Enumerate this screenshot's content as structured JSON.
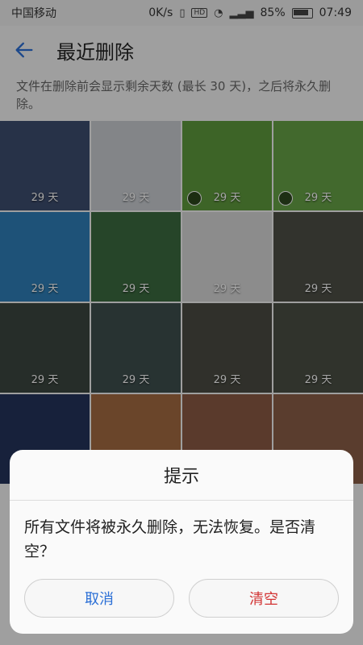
{
  "status": {
    "carrier": "中国移动",
    "speed": "0K/s",
    "battery": "85%",
    "time": "07:49",
    "hd": "HD",
    "signal_text": "4G"
  },
  "appbar": {
    "title": "最近删除"
  },
  "note": {
    "text": "文件在删除前会显示剩余天数 (最长 30 天)，之后将永久删除。"
  },
  "tiles": [
    {
      "label": "29 天",
      "color": "#3d4d6f"
    },
    {
      "label": "29 天",
      "color": "#c9cdd2"
    },
    {
      "label": "29 天",
      "color": "#5f9a3d"
    },
    {
      "label": "29 天",
      "color": "#66a246"
    },
    {
      "label": "29 天",
      "color": "#2e7fb8"
    },
    {
      "label": "29 天",
      "color": "#3b6a3f"
    },
    {
      "label": "29 天",
      "color": "#d7d7d7"
    },
    {
      "label": "29 天",
      "color": "#4d4f46"
    },
    {
      "label": "29 天",
      "color": "#3b463f"
    },
    {
      "label": "29 天",
      "color": "#3e4f4e"
    },
    {
      "label": "29 天",
      "color": "#4a4b42"
    },
    {
      "label": "29 天",
      "color": "#4a4f44"
    },
    {
      "label": "",
      "color": "#24345b"
    },
    {
      "label": "",
      "color": "#a46b41"
    },
    {
      "label": "",
      "color": "#8b5a44"
    },
    {
      "label": "",
      "color": "#8a5e47"
    }
  ],
  "dialog": {
    "title": "提示",
    "message": "所有文件将被永久删除，无法恢复。是否清空？",
    "cancel": "取消",
    "clear": "清空"
  }
}
